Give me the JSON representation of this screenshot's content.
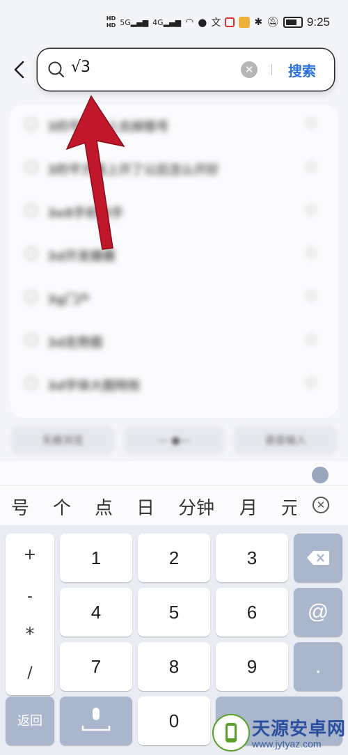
{
  "status_bar": {
    "time": "9:25",
    "icons": [
      "hd-icon",
      "5g-signal-icon",
      "4g-signal-icon",
      "wifi-icon",
      "qq-icon",
      "translate-icon",
      "app-icon",
      "app-icon-2",
      "bluetooth-icon",
      "mute-icon",
      "battery-icon"
    ]
  },
  "search": {
    "value": "√3",
    "button_label": "搜索",
    "icon": "search-icon",
    "clear_icon": "clear-icon"
  },
  "suggestions": [
    {
      "text": "3的平方根上去掉根号"
    },
    {
      "text": "3的平方根上开了以后怎么开好"
    },
    {
      "text": "3e8手机助手"
    },
    {
      "text": "3d开发建模"
    },
    {
      "text": "3g门户"
    },
    {
      "text": "3d走势图"
    },
    {
      "text": "3d字体大图特效"
    }
  ],
  "bottom_bar": {
    "left": "无痕浏览",
    "right": "语音输入"
  },
  "keyboard": {
    "candidates": [
      "号",
      "个",
      "点",
      "日",
      "分钟",
      "月",
      "元"
    ],
    "symbols": [
      "+",
      "-",
      "*",
      "/"
    ],
    "digits": [
      "1",
      "2",
      "3",
      "4",
      "5",
      "6",
      "7",
      "8",
      "9",
      "0"
    ],
    "return_label": "返回",
    "at_label": "@",
    "dot_label": ".",
    "colors": {
      "dark_key": "#a9b6cc",
      "accent": "#2b6fe0",
      "arrow": "#c0182a"
    }
  },
  "watermark": {
    "name": "天源安卓网",
    "url": "www.jytyaz.com"
  }
}
